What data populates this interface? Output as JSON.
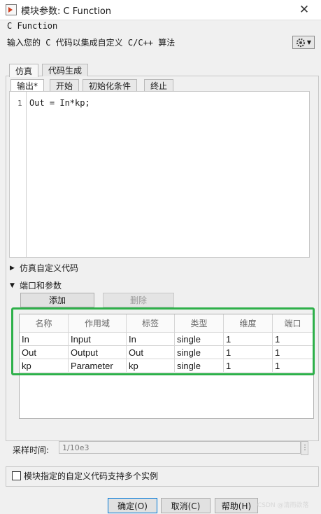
{
  "window": {
    "title": "模块参数: C Function",
    "close_glyph": "✕"
  },
  "block": {
    "type": "C Function",
    "description": "输入您的 C 代码以集成自定义 C/C++ 算法"
  },
  "tabs": [
    {
      "label": "仿真",
      "active": true
    },
    {
      "label": "代码生成",
      "active": false
    }
  ],
  "subtabs": [
    {
      "label": "输出*",
      "active": true
    },
    {
      "label": "开始",
      "active": false
    },
    {
      "label": "初始化条件",
      "active": false
    },
    {
      "label": "终止",
      "active": false
    }
  ],
  "editor": {
    "line_number": "1",
    "code": "Out = In*kp;"
  },
  "sections": {
    "sim_custom_code": "仿真自定义代码",
    "ports_params": "端口和参数"
  },
  "buttons": {
    "add": "添加",
    "delete": "删除",
    "ok": "确定(O)",
    "cancel": "取消(C)",
    "help": "帮助(H)"
  },
  "table": {
    "headers": [
      "名称",
      "作用域",
      "标签",
      "类型",
      "维度",
      "端口"
    ],
    "rows": [
      [
        "In",
        "Input",
        "In",
        "single",
        "1",
        "1"
      ],
      [
        "Out",
        "Output",
        "Out",
        "single",
        "1",
        "1"
      ],
      [
        "kp",
        "Parameter",
        "kp",
        "single",
        "1",
        "1"
      ]
    ]
  },
  "sample_time": {
    "label": "采样时间:",
    "value": "1/10e3"
  },
  "multi_instance": {
    "label": "模块指定的自定义代码支持多个实例",
    "checked": false
  },
  "watermark": "CSDN @清雨欲落",
  "colors": {
    "highlight_box": "#2eb04a",
    "accent": "#0078d7"
  }
}
